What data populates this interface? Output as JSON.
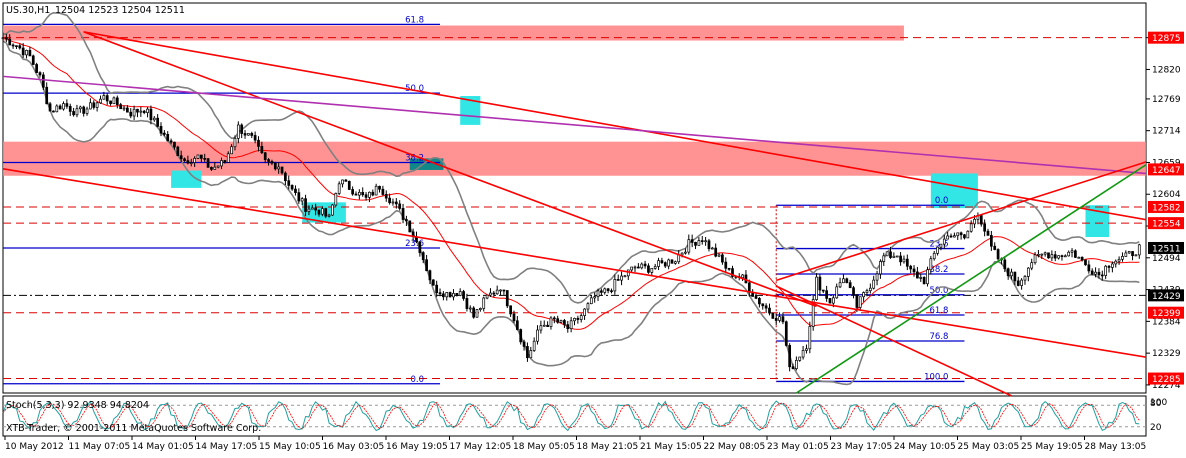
{
  "header": {
    "symbol_tf": "US.30,H1",
    "ohlc": "12504 12523 12504 12511"
  },
  "indicator": {
    "label": "Stoch(5,3,3) 92.9348 94.8204",
    "levels": [
      "80",
      "20"
    ],
    "top_value": "100"
  },
  "watermark": "XTB-Trader, © 2001-2011 MetaQuotes Software Corp.",
  "chart_data": {
    "type": "candlestick",
    "symbol": "US.30",
    "timeframe": "H1",
    "current_price": 12511,
    "ylim": [
      12260,
      12935
    ],
    "price_ticks": [
      12875,
      12820,
      12769,
      12714,
      12659,
      12604,
      12549,
      12494,
      12439,
      12384,
      12329,
      12274
    ],
    "tagged_levels": [
      {
        "label": "12875",
        "value": 12875,
        "bg": "#ff0000",
        "fg": "#ffffff"
      },
      {
        "label": "12647",
        "value": 12647,
        "bg": "#ff0000",
        "fg": "#ffffff"
      },
      {
        "label": "12582",
        "value": 12582,
        "bg": "#ff0000",
        "fg": "#ffffff"
      },
      {
        "label": "12554",
        "value": 12554,
        "bg": "#ff0000",
        "fg": "#ffffff"
      },
      {
        "label": "12511",
        "value": 12511,
        "bg": "#000000",
        "fg": "#ffffff"
      },
      {
        "label": "12429",
        "value": 12429,
        "bg": "#000000",
        "fg": "#ffffff"
      },
      {
        "label": "12399",
        "value": 12399,
        "bg": "#ff0000",
        "fg": "#ffffff"
      },
      {
        "label": "12285",
        "value": 12285,
        "bg": "#ff0000",
        "fg": "#ffffff"
      }
    ],
    "x_labels": [
      "10 May 2012",
      "11 May 07:05",
      "14 May 01:05",
      "14 May 17:05",
      "15 May 10:05",
      "16 May 03:05",
      "16 May 19:05",
      "17 May 12:05",
      "18 May 05:05",
      "18 May 21:05",
      "21 May 15:05",
      "22 May 08:05",
      "23 May 01:05",
      "23 May 17:05",
      "24 May 10:05",
      "25 May 03:05",
      "25 May 19:05",
      "28 May 13:05"
    ],
    "close_path": [
      [
        0,
        12875
      ],
      [
        4,
        12862
      ],
      [
        8,
        12842
      ],
      [
        11,
        12806
      ],
      [
        14,
        12748
      ],
      [
        18,
        12760
      ],
      [
        22,
        12745
      ],
      [
        26,
        12755
      ],
      [
        30,
        12772
      ],
      [
        34,
        12760
      ],
      [
        38,
        12745
      ],
      [
        42,
        12752
      ],
      [
        46,
        12722
      ],
      [
        50,
        12690
      ],
      [
        54,
        12663
      ],
      [
        58,
        12669
      ],
      [
        62,
        12648
      ],
      [
        66,
        12660
      ],
      [
        70,
        12720
      ],
      [
        74,
        12700
      ],
      [
        78,
        12660
      ],
      [
        82,
        12654
      ],
      [
        86,
        12610
      ],
      [
        90,
        12582
      ],
      [
        94,
        12576
      ],
      [
        97,
        12562
      ],
      [
        100,
        12628
      ],
      [
        104,
        12612
      ],
      [
        108,
        12596
      ],
      [
        112,
        12618
      ],
      [
        116,
        12590
      ],
      [
        120,
        12558
      ],
      [
        124,
        12510
      ],
      [
        128,
        12442
      ],
      [
        132,
        12432
      ],
      [
        136,
        12436
      ],
      [
        140,
        12392
      ],
      [
        144,
        12426
      ],
      [
        148,
        12445
      ],
      [
        152,
        12390
      ],
      [
        156,
        12322
      ],
      [
        160,
        12376
      ],
      [
        164,
        12386
      ],
      [
        168,
        12372
      ],
      [
        172,
        12394
      ],
      [
        176,
        12426
      ],
      [
        180,
        12438
      ],
      [
        184,
        12460
      ],
      [
        188,
        12478
      ],
      [
        192,
        12476
      ],
      [
        196,
        12483
      ],
      [
        200,
        12492
      ],
      [
        204,
        12518
      ],
      [
        208,
        12528
      ],
      [
        212,
        12500
      ],
      [
        216,
        12470
      ],
      [
        220,
        12458
      ],
      [
        224,
        12424
      ],
      [
        228,
        12401
      ],
      [
        232,
        12384
      ],
      [
        234,
        12299
      ],
      [
        236,
        12318
      ],
      [
        239,
        12344
      ],
      [
        242,
        12455
      ],
      [
        246,
        12418
      ],
      [
        250,
        12462
      ],
      [
        254,
        12410
      ],
      [
        258,
        12448
      ],
      [
        262,
        12496
      ],
      [
        266,
        12500
      ],
      [
        270,
        12470
      ],
      [
        274,
        12455
      ],
      [
        278,
        12515
      ],
      [
        282,
        12536
      ],
      [
        286,
        12528
      ],
      [
        290,
        12574
      ],
      [
        294,
        12510
      ],
      [
        298,
        12476
      ],
      [
        302,
        12450
      ],
      [
        306,
        12488
      ],
      [
        310,
        12502
      ],
      [
        314,
        12498
      ],
      [
        318,
        12505
      ],
      [
        322,
        12482
      ],
      [
        326,
        12465
      ],
      [
        330,
        12490
      ],
      [
        334,
        12495
      ],
      [
        338,
        12511
      ]
    ],
    "zones": [
      {
        "name": "resistance-zone-top",
        "price_from": 12870,
        "price_to": 12896,
        "x_from": 0,
        "x_to": 268,
        "color": "#ff8080"
      },
      {
        "name": "resistance-zone-mid",
        "price_from": 12636,
        "price_to": 12695,
        "x_from": 0,
        "x_to": 340,
        "color": "#ff8080"
      }
    ],
    "fibonacci_left": {
      "x_from": 0,
      "x_to": 130,
      "levels": [
        {
          "label": "61.8",
          "value": 12898
        },
        {
          "label": "50.0",
          "value": 12779
        },
        {
          "label": "38.2",
          "value": 12659
        },
        {
          "label": "23.6",
          "value": 12511
        },
        {
          "label": "0.0",
          "value": 12276
        }
      ]
    },
    "fibonacci_right": {
      "x_from": 230,
      "x_to": 286,
      "levels": [
        {
          "label": "0.0",
          "value": 12585
        },
        {
          "label": "23.6",
          "value": 12510
        },
        {
          "label": "38.2",
          "value": 12466
        },
        {
          "label": "50.0",
          "value": 12430
        },
        {
          "label": "61.8",
          "value": 12395
        },
        {
          "label": "76.8",
          "value": 12350
        },
        {
          "label": "100.0",
          "value": 12280
        }
      ]
    },
    "horizontal_dashed_red": [
      12875,
      12582,
      12554,
      12399,
      12285
    ],
    "horizontal_dashdot_black": [
      12429
    ],
    "trendlines": [
      {
        "name": "downtrend-upper",
        "color": "#ff0000",
        "from": [
          24,
          12885
        ],
        "to": [
          340,
          12560
        ]
      },
      {
        "name": "downtrend-lower",
        "color": "#ff0000",
        "from": [
          0,
          12648
        ],
        "to": [
          340,
          12322
        ]
      },
      {
        "name": "downtrend-steep",
        "color": "#ff0000",
        "from": [
          24,
          12885
        ],
        "to": [
          242,
          12410
        ]
      },
      {
        "name": "magenta-line",
        "color": "#b030b0",
        "from": [
          0,
          12808
        ],
        "to": [
          340,
          12640
        ]
      },
      {
        "name": "channel-upper",
        "color": "#ff0000",
        "from": [
          230,
          12455
        ],
        "to": [
          340,
          12660
        ]
      },
      {
        "name": "green-line",
        "color": "#119911",
        "from": [
          236,
          12260
        ],
        "to": [
          340,
          12655
        ]
      },
      {
        "name": "red-down-right",
        "color": "#ff0000",
        "from": [
          230,
          12445
        ],
        "to": [
          300,
          12255
        ]
      }
    ],
    "highlight_boxes": [
      {
        "name": "cyan-box-1",
        "x_from": 50,
        "x_to": 59,
        "price_from": 12615,
        "price_to": 12645
      },
      {
        "name": "cyan-box-2",
        "x_from": 89,
        "x_to": 102,
        "price_from": 12555,
        "price_to": 12590
      },
      {
        "name": "cyan-box-3",
        "x_from": 136,
        "x_to": 142,
        "price_from": 12724,
        "price_to": 12774
      },
      {
        "name": "cyan-box-4",
        "x_from": 276,
        "x_to": 290,
        "price_from": 12580,
        "price_to": 12640
      },
      {
        "name": "cyan-box-5",
        "x_from": 322,
        "x_to": 329,
        "price_from": 12530,
        "price_to": 12585
      },
      {
        "name": "teal-box",
        "x_from": 121,
        "x_to": 131,
        "price_from": 12646,
        "price_to": 12666
      }
    ],
    "colors": {
      "bull": "#ffffff",
      "bear": "#000000",
      "bands": "#808080",
      "ma": "#ff0000",
      "fib": "#0000cc",
      "stoch_main": "#20a0a0",
      "stoch_signal": "#ff0000"
    },
    "grid": false,
    "legend": "none"
  }
}
